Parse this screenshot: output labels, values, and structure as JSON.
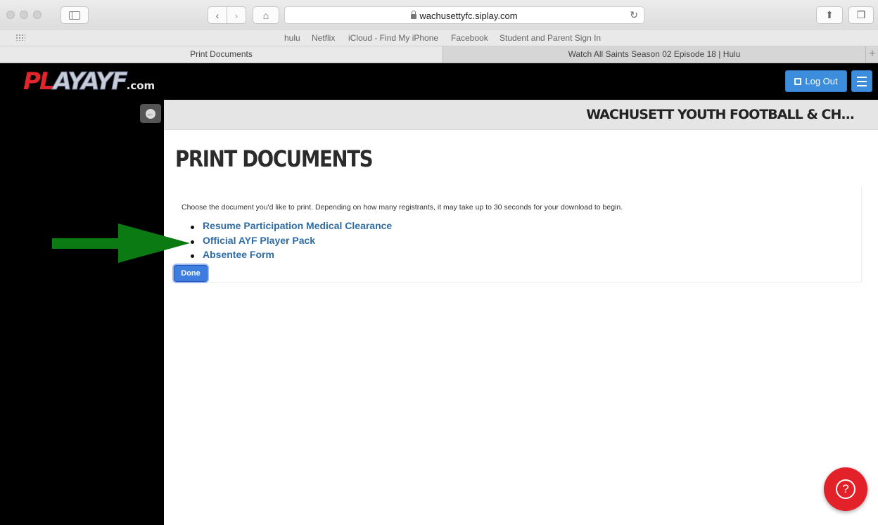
{
  "browser": {
    "url": "wachusettyfc.siplay.com",
    "favorites": [
      "hulu",
      "Netflix",
      "iCloud - Find My iPhone",
      "Facebook",
      "Student and Parent Sign In"
    ],
    "tabs": [
      {
        "label": "Print Documents",
        "active": true
      },
      {
        "label": "Watch All Saints Season 02 Episode 18 | Hulu",
        "active": false
      }
    ]
  },
  "header": {
    "logo_play": "PL",
    "logo_ayf": "AYAYF",
    "logo_com": ".com",
    "logout_label": "Log Out",
    "accent_color": "#3c8ddc"
  },
  "titlebar": {
    "org_name": "WACHUSETT YOUTH FOOTBALL & CH..."
  },
  "main": {
    "title": "PRINT DOCUMENTS",
    "intro": "Choose the document you'd like to print. Depending on how many registrants, it may take up to 30 seconds for your download to begin.",
    "documents": [
      {
        "label": "Resume Participation Medical Clearance"
      },
      {
        "label": "Official AYF Player Pack"
      },
      {
        "label": "Absentee Form"
      }
    ],
    "done_label": "Done"
  },
  "annotation": {
    "arrow_color": "#0b7a13"
  },
  "help": {
    "icon": "question-icon",
    "symbol": "?",
    "color": "#e32129"
  }
}
